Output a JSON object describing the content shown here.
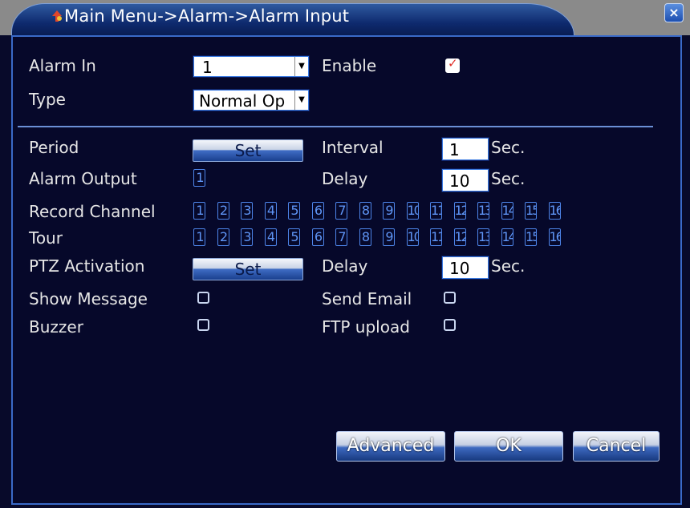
{
  "window": {
    "title": "Main Menu->Alarm->Alarm Input",
    "close_glyph": "×"
  },
  "form": {
    "alarm_in": {
      "label": "Alarm In",
      "value": "1"
    },
    "enable": {
      "label": "Enable",
      "checked": true
    },
    "type": {
      "label": "Type",
      "value": "Normal Op"
    },
    "period": {
      "label": "Period",
      "button": "Set"
    },
    "interval": {
      "label": "Interval",
      "value": "1",
      "unit": "Sec."
    },
    "alarm_output": {
      "label": "Alarm Output",
      "channels": [
        "1"
      ]
    },
    "delay1": {
      "label": "Delay",
      "value": "10",
      "unit": "Sec."
    },
    "record_channel": {
      "label": "Record Channel",
      "channels": [
        "1",
        "2",
        "3",
        "4",
        "5",
        "6",
        "7",
        "8",
        "9",
        "10",
        "11",
        "12",
        "13",
        "14",
        "15",
        "16"
      ]
    },
    "tour": {
      "label": "Tour",
      "channels": [
        "1",
        "2",
        "3",
        "4",
        "5",
        "6",
        "7",
        "8",
        "9",
        "10",
        "11",
        "12",
        "13",
        "14",
        "15",
        "16"
      ]
    },
    "ptz": {
      "label": "PTZ Activation",
      "button": "Set"
    },
    "delay2": {
      "label": "Delay",
      "value": "10",
      "unit": "Sec."
    },
    "show_message": {
      "label": "Show Message",
      "checked": false
    },
    "send_email": {
      "label": "Send Email",
      "checked": false
    },
    "buzzer": {
      "label": "Buzzer",
      "checked": false
    },
    "ftp_upload": {
      "label": "FTP upload",
      "checked": false
    }
  },
  "buttons": {
    "advanced": "Advanced",
    "ok": "OK",
    "cancel": "Cancel"
  },
  "colors": {
    "background": "#06082a",
    "accent": "#3a6ac8",
    "channel_box": "#5f95f5",
    "check_mark": "#e0312a"
  }
}
